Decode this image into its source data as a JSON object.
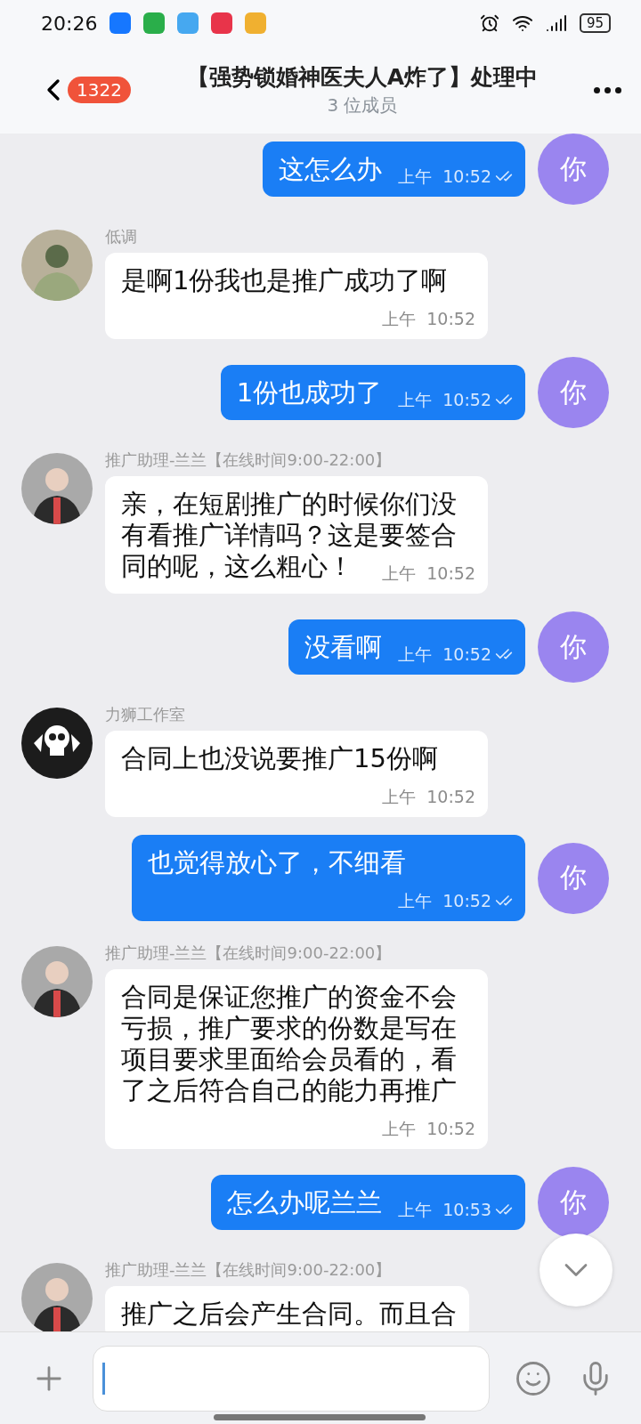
{
  "status_bar": {
    "time": "20:26",
    "battery": "95"
  },
  "header": {
    "unread": "1322",
    "title": "【强势锁婚神医夫人A炸了】处理中",
    "subtitle": "3 位成员"
  },
  "messages": [
    {
      "kind": "outgoing",
      "text": "这怎么办",
      "time": "上午  10:52",
      "read": true,
      "avatar": "你"
    },
    {
      "kind": "incoming",
      "sender": "低调",
      "text": "是啊1份我也是推广成功了啊",
      "time": "上午  10:52"
    },
    {
      "kind": "outgoing",
      "text": "1份也成功了",
      "time": "上午  10:52",
      "read": true,
      "avatar": "你"
    },
    {
      "kind": "incoming",
      "sender": "推广助理-兰兰【在线时间9:00-22:00】",
      "text": "亲，在短剧推广的时候你们没有看推广详情吗？这是要签合同的呢，这么粗心！",
      "time": "上午  10:52"
    },
    {
      "kind": "outgoing",
      "text": "没看啊",
      "time": "上午  10:52",
      "read": true,
      "avatar": "你"
    },
    {
      "kind": "incoming",
      "sender": "力狮工作室",
      "text": "合同上也没说要推广15份啊",
      "time": "上午  10:52",
      "avatar": {
        "kind": "logo"
      }
    },
    {
      "kind": "outgoing",
      "text": "也觉得放心了，不细看",
      "time": "上午  10:52",
      "read": true,
      "avatar": "你"
    },
    {
      "kind": "incoming",
      "sender": "推广助理-兰兰【在线时间9:00-22:00】",
      "text": "合同是保证您推广的资金不会亏损，推广要求的份数是写在项目要求里面给会员看的，看了之后符合自己的能力再推广",
      "time": "上午  10:52"
    },
    {
      "kind": "outgoing",
      "text": "怎么办呢兰兰",
      "time": "上午  10:53",
      "read": true,
      "avatar": "你"
    },
    {
      "kind": "incoming",
      "sender": "推广助理-兰兰【在线时间9:00-22:00】",
      "text": "推广之后会产生合同。而且合"
    }
  ]
}
